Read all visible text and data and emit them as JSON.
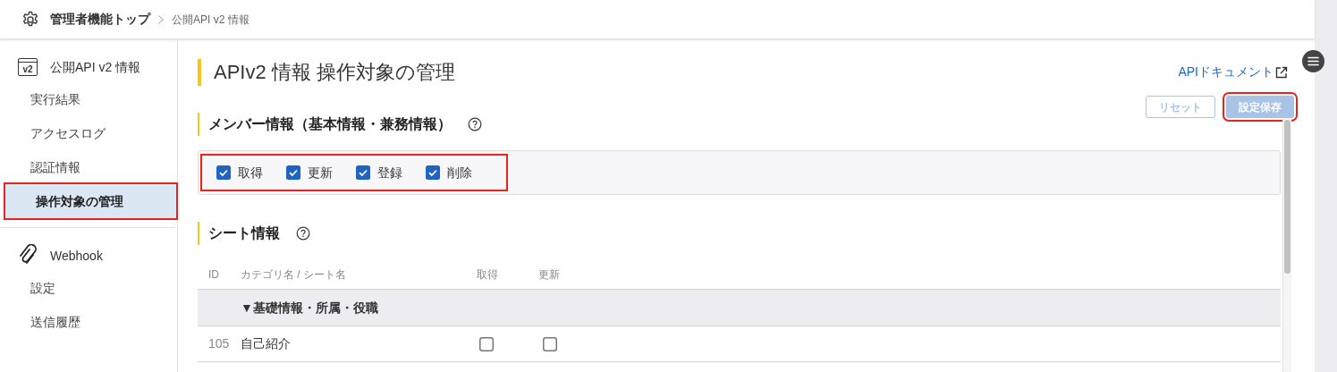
{
  "breadcrumb": [
    {
      "label": "管理者機能トップ"
    },
    {
      "label": "公開API v2 情報"
    }
  ],
  "sidebar": {
    "sections": [
      {
        "title": "公開API v2 情報",
        "icon_text": "v2",
        "items": [
          {
            "label": "実行結果",
            "selected": false,
            "highlighted": false
          },
          {
            "label": "アクセスログ",
            "selected": false,
            "highlighted": false
          },
          {
            "label": "認証情報",
            "selected": false,
            "highlighted": false
          },
          {
            "label": "操作対象の管理",
            "selected": true,
            "highlighted": true
          }
        ]
      },
      {
        "title": "Webhook",
        "items": [
          {
            "label": "設定",
            "selected": false,
            "highlighted": false
          },
          {
            "label": "送信履歴",
            "selected": false,
            "highlighted": false
          }
        ]
      }
    ]
  },
  "page": {
    "title": "APIv2 情報 操作対象の管理",
    "doc_link": "APIドキュメント",
    "buttons": [
      {
        "label": "リセット",
        "kind": "outline",
        "disabled": true,
        "highlighted": false
      },
      {
        "label": "設定保存",
        "kind": "primary",
        "disabled": true,
        "highlighted": true
      }
    ]
  },
  "member_section": {
    "title": "メンバー情報（基本情報・兼務情報）",
    "highlighted": true,
    "checkboxes": [
      {
        "label": "取得",
        "checked": true
      },
      {
        "label": "更新",
        "checked": true
      },
      {
        "label": "登録",
        "checked": true
      },
      {
        "label": "削除",
        "checked": true
      }
    ]
  },
  "sheet_section": {
    "title": "シート情報",
    "table": {
      "columns": [
        "ID",
        "カテゴリ名 / シート名",
        "取得",
        "更新"
      ],
      "rows": [
        {
          "kind": "group",
          "label": "▼基礎情報・所属・役職"
        },
        {
          "kind": "sheet",
          "id": "105",
          "name": "自己紹介",
          "get": false,
          "update": false
        }
      ]
    }
  }
}
